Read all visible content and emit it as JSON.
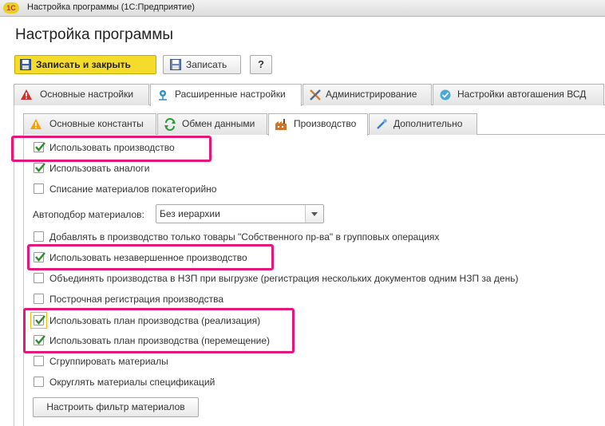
{
  "window": {
    "title": "Настройка программы (1С:Предприятие)",
    "logo_text": "1С"
  },
  "page_title": "Настройка программы",
  "toolbar": {
    "save_close_label": "Записать и закрыть",
    "save_label": "Записать",
    "help_label": "?"
  },
  "main_tabs": [
    {
      "label": "Основные настройки",
      "icon": "warning-icon",
      "active": false
    },
    {
      "label": "Расширенные настройки",
      "icon": "settings-node-icon",
      "active": true
    },
    {
      "label": "Администрирование",
      "icon": "tools-icon",
      "active": false
    },
    {
      "label": "Настройки автогашения ВСД",
      "icon": "vsd-check-icon",
      "active": false
    }
  ],
  "sub_tabs": [
    {
      "label": "Основные константы",
      "icon": "warning-icon",
      "active": false
    },
    {
      "label": "Обмен данными",
      "icon": "exchange-icon",
      "active": false
    },
    {
      "label": "Производство",
      "icon": "factory-icon",
      "active": true
    },
    {
      "label": "Дополнительно",
      "icon": "pipette-icon",
      "active": false
    }
  ],
  "options": [
    {
      "label": "Использовать производство",
      "checked": true
    },
    {
      "label": "Использовать аналоги",
      "checked": true
    },
    {
      "label": "Списание материалов покатегорийно",
      "checked": false
    },
    {
      "label": "Добавлять в производство только товары  \"Собственного пр-ва\" в групповых операциях",
      "checked": false
    },
    {
      "label": "Использовать незавершенное производство",
      "checked": true
    },
    {
      "label": "Объединять производства в НЗП при выгрузке (регистрация нескольких документов одним НЗП за день)",
      "checked": false
    },
    {
      "label": "Построчная регистрация производства",
      "checked": false
    },
    {
      "label": "Использовать план производства (реализация)",
      "checked": true
    },
    {
      "label": "Использовать план производства (перемещение)",
      "checked": true
    },
    {
      "label": "Сгруппировать материалы",
      "checked": false
    },
    {
      "label": "Округлять материалы спецификаций",
      "checked": false
    }
  ],
  "autoselect": {
    "label": "Автоподбор материалов:",
    "value": "Без иерархии"
  },
  "filter_button_label": "Настроить фильтр материалов",
  "colors": {
    "accent_button": "#f5dc2b",
    "highlight": "#e4187a",
    "check": "#2e8b2e"
  }
}
